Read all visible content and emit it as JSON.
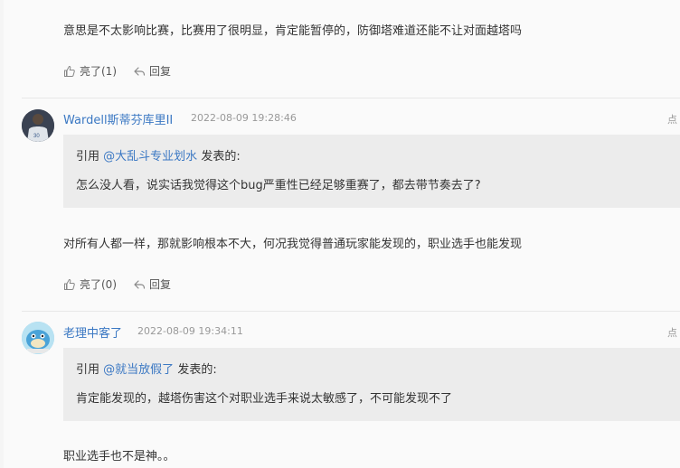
{
  "colors": {
    "link": "#3b78c3",
    "meta": "#999999",
    "quote_bg": "#ececec"
  },
  "post0": {
    "content": "意思是不太影响比赛，比赛用了很明显，肯定能暂停的，防御塔难道还能不让对面越塔吗",
    "like_label": "亮了(1)",
    "reply_label": "回复"
  },
  "post1": {
    "username": "Wardell斯蒂芬库里II",
    "time": "2022-08-09 19:28:46",
    "right_link": "点",
    "quote_prefix": "引用",
    "quote_user": "@大乱斗专业划水",
    "quote_suffix": "发表的:",
    "quote_text": "怎么没人看，说实话我觉得这个bug严重性已经足够重赛了，都去带节奏去了?",
    "content": "对所有人都一样，那就影响根本不大，何况我觉得普通玩家能发现的，职业选手也能发现",
    "like_label": "亮了(0)",
    "reply_label": "回复"
  },
  "post2": {
    "username": "老理中客了",
    "time": "2022-08-09 19:34:11",
    "right_link": "点",
    "quote_prefix": "引用",
    "quote_user": "@就当放假了",
    "quote_suffix": "发表的:",
    "quote_text": "肯定能发现的，越塔伤害这个对职业选手来说太敏感了，不可能发现不了",
    "content": "职业选手也不是神。。"
  },
  "icons": {
    "like": "thumb-up-icon",
    "reply": "reply-arrow-icon"
  }
}
